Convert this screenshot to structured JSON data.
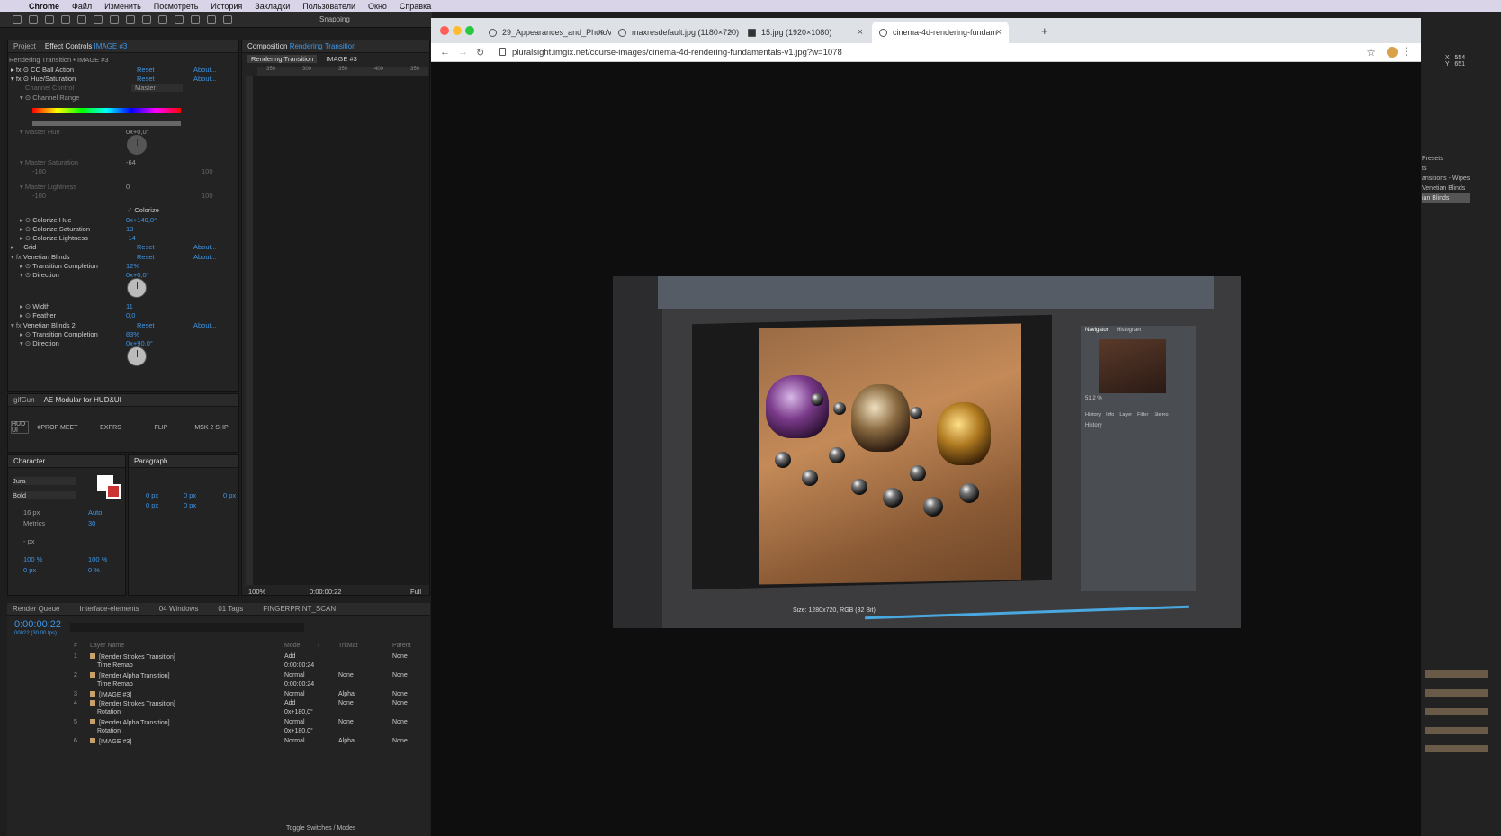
{
  "menubar": {
    "apple_icon": "apple-icon",
    "app_name": "Chrome",
    "items": [
      "Файл",
      "Изменить",
      "Посмотреть",
      "История",
      "Закладки",
      "Пользователи",
      "Окно",
      "Справка"
    ]
  },
  "ae": {
    "snapping_label": "Snapping",
    "project_tab": "Project",
    "effect_controls_tab": "Effect Controls",
    "effect_controls_target": "IMAGE #3",
    "breadcrumb": "Rendering Transition • IMAGE #3",
    "effects": [
      {
        "name": "CC Ball Action",
        "reset": "Reset",
        "about": "About..."
      },
      {
        "name": "Hue/Saturation",
        "reset": "Reset",
        "about": "About..."
      }
    ],
    "channel_control_label": "Channel Control",
    "channel_control_value": "Master",
    "channel_range_label": "Channel Range",
    "master_hue_label": "Master Hue",
    "master_hue_value": "0x+0,0°",
    "master_saturation_label": "Master Saturation",
    "master_saturation_value": "-64",
    "sat_min": "-100",
    "sat_max": "100",
    "master_lightness_label": "Master Lightness",
    "master_lightness_value": "0",
    "light_min": "-100",
    "light_max": "100",
    "colorize_label": "Colorize",
    "colorize_hue_label": "Colorize Hue",
    "colorize_hue_value": "0x+140,0°",
    "colorize_sat_label": "Colorize Saturation",
    "colorize_sat_value": "13",
    "colorize_light_label": "Colorize Lightness",
    "colorize_light_value": "-14",
    "grid_label": "Grid",
    "grid_reset": "Reset",
    "grid_about": "About...",
    "vb_label": "Venetian Blinds",
    "vb_reset": "Reset",
    "vb_about": "About...",
    "vb_tc_label": "Transition Completion",
    "vb_tc_value": "12%",
    "vb_dir_label": "Direction",
    "vb_dir_value": "0x+0,0°",
    "vb_width_label": "Width",
    "vb_width_value": "11",
    "vb_feather_label": "Feather",
    "vb_feather_value": "0,0",
    "vb2_label": "Venetian Blinds 2",
    "vb2_reset": "Reset",
    "vb2_about": "About...",
    "vb2_tc_label": "Transition Completion",
    "vb2_tc_value": "83%",
    "vb2_dir_label": "Direction",
    "vb2_dir_value": "0x+90,0°",
    "composition_tab": "Composition",
    "composition_name": "Rendering Transition",
    "comp_breadcrumb_1": "Rendering Transition",
    "comp_breadcrumb_2": "IMAGE #3",
    "ruler_ticks": [
      "350",
      "300",
      "350",
      "400",
      "350"
    ],
    "gifgun_tab": "gifGun",
    "modular_tab": "AE Modular for HUD&UI",
    "hud_label": "HUD UI",
    "buttons": [
      "#PROP MEET",
      "EXPRS",
      "FLIP",
      "MSK 2 SHP"
    ],
    "character_tab": "Character",
    "font_family": "Jura",
    "font_style": "Bold",
    "font_size": "16 px",
    "leading": "Auto",
    "kerning": "Metrics",
    "tracking": "30",
    "stroke_width": "- px",
    "vscale": "100 %",
    "hscale": "100 %",
    "baseline": "0 px",
    "tsume": "0 %",
    "paragraph_tab": "Paragraph",
    "para_values": [
      "0 px",
      "0 px",
      "0 px",
      "0 px",
      "0 px"
    ],
    "zoom": "100%",
    "timecode_view": "0:00:00:22",
    "res": "Full",
    "timeline_tabs": [
      "Render Queue",
      "Interface-elements",
      "04 Windows",
      "01 Tags",
      "FINGERPRINT_SCAN"
    ],
    "timecode": "0:00:00:22",
    "timecode_sub": "00022 (30.00 fps)",
    "col_headers": {
      "num": "#",
      "layer": "Layer Name",
      "mode": "Mode",
      "t": "T",
      "trkmat": "TrkMat",
      "parent": "Parent"
    },
    "layers": [
      {
        "idx": "1",
        "name": "[Render Strokes Transition]",
        "mode": "Add",
        "trk": "",
        "parent": "None"
      },
      {
        "idx": "",
        "name": "Time Remap",
        "mode": "0:00:00:24",
        "trk": "",
        "parent": ""
      },
      {
        "idx": "2",
        "name": "[Render Alpha Transition]",
        "mode": "Normal",
        "trk": "None",
        "parent": "None"
      },
      {
        "idx": "",
        "name": "Time Remap",
        "mode": "0:00:00:24",
        "trk": "",
        "parent": ""
      },
      {
        "idx": "3",
        "name": "[IMAGE #3]",
        "mode": "Normal",
        "trk": "Alpha",
        "parent": "None"
      },
      {
        "idx": "4",
        "name": "[Render Strokes Transition]",
        "mode": "Add",
        "trk": "None",
        "parent": "None"
      },
      {
        "idx": "",
        "name": "Rotation",
        "mode": "0x+180,0°",
        "trk": "",
        "parent": ""
      },
      {
        "idx": "5",
        "name": "[Render Alpha Transition]",
        "mode": "Normal",
        "trk": "None",
        "parent": "None"
      },
      {
        "idx": "",
        "name": "Rotation",
        "mode": "0x+180,0°",
        "trk": "",
        "parent": ""
      },
      {
        "idx": "6",
        "name": "[IMAGE #3]",
        "mode": "Normal",
        "trk": "Alpha",
        "parent": "None"
      }
    ],
    "toggle_label": "Toggle Switches / Modes",
    "coords": "X : 554\nY : 651",
    "right_items": [
      "Presets",
      "ts",
      "ansitions - Wipes",
      "Venetian Blinds",
      "ian Blinds"
    ]
  },
  "chrome": {
    "tabs": [
      {
        "title": "29_Appearances_and_PhotoVi",
        "active": false
      },
      {
        "title": "maxresdefault.jpg (1180×720)",
        "active": false
      },
      {
        "title": "15.jpg (1920×1080)",
        "active": false
      },
      {
        "title": "cinema-4d-rendering-fundam",
        "active": true
      }
    ],
    "new_tab": "+",
    "url": "pluralsight.imgix.net/course-images/cinema-4d-rendering-fundamentals-v1.jpg?w=1078",
    "image": {
      "navigator_tab": "Navigator",
      "histogram_tab": "Histogram",
      "zoom_text": "51,2 %",
      "history_tabs": [
        "History",
        "Info",
        "Layer",
        "Filter",
        "Stereo"
      ],
      "history_label": "History",
      "status_text": "Size: 1280x720, RGB (32 Bit)"
    }
  },
  "colors": {
    "ae_blue": "#3d95e6",
    "menubar_bg": "#d9d4e8",
    "chrome_tab_bg": "#dee1e6"
  }
}
